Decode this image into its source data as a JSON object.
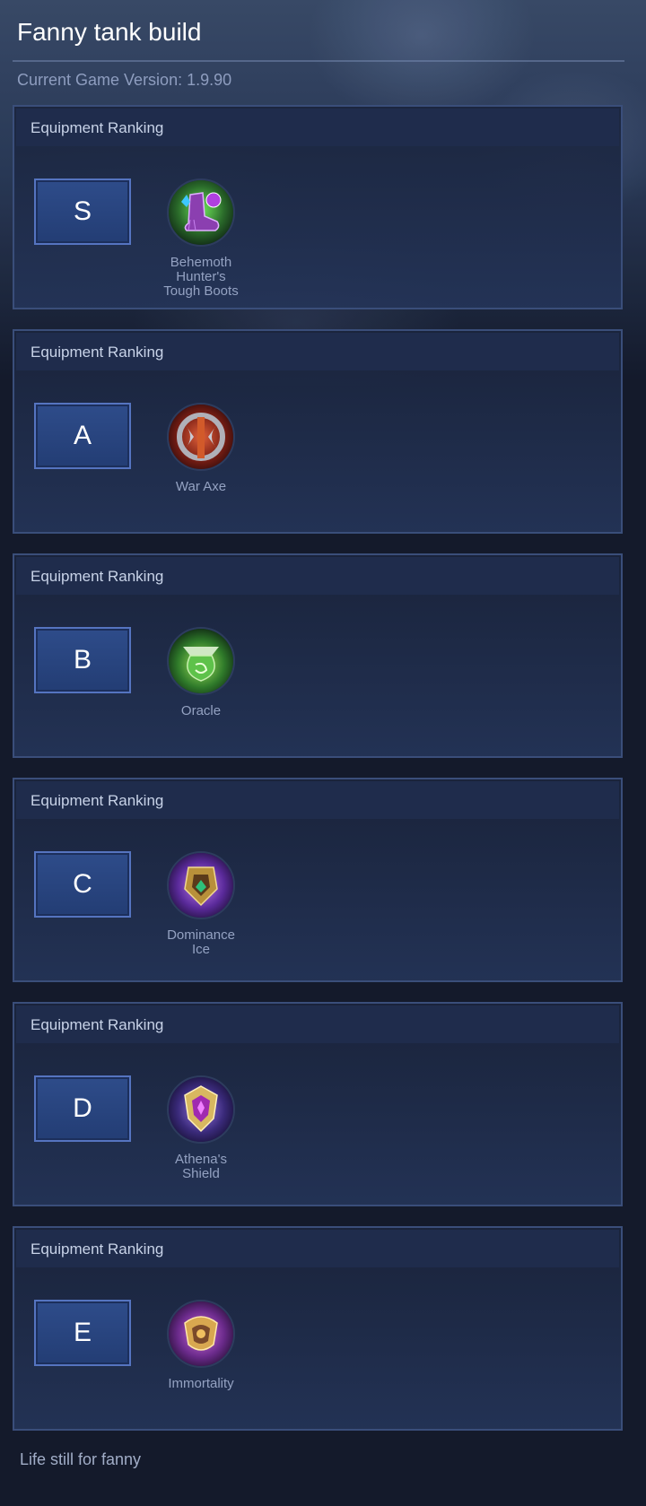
{
  "page": {
    "title": "Fanny tank build",
    "version": "Current Game Version: 1.9.90",
    "footer_note": "Life still for fanny"
  },
  "rankings": [
    {
      "header": "Equipment Ranking",
      "tier": "S",
      "item_name": "Behemoth Hunter's Tough Boots",
      "icon": "purple-boots-icon"
    },
    {
      "header": "Equipment Ranking",
      "tier": "A",
      "item_name": "War Axe",
      "icon": "war-axe-icon"
    },
    {
      "header": "Equipment Ranking",
      "tier": "B",
      "item_name": "Oracle",
      "icon": "oracle-icon"
    },
    {
      "header": "Equipment Ranking",
      "tier": "C",
      "item_name": "Dominance Ice",
      "icon": "dominance-ice-icon"
    },
    {
      "header": "Equipment Ranking",
      "tier": "D",
      "item_name": "Athena's Shield",
      "icon": "athenas-shield-icon"
    },
    {
      "header": "Equipment Ranking",
      "tier": "E",
      "item_name": "Immortality",
      "icon": "immortality-icon"
    }
  ],
  "colors": {
    "background": "#141a2b",
    "card_border": "#3a4e7a",
    "tier_fill": "#2e4c8a",
    "tier_border": "#5574c0",
    "muted_text": "#94a2c2"
  }
}
